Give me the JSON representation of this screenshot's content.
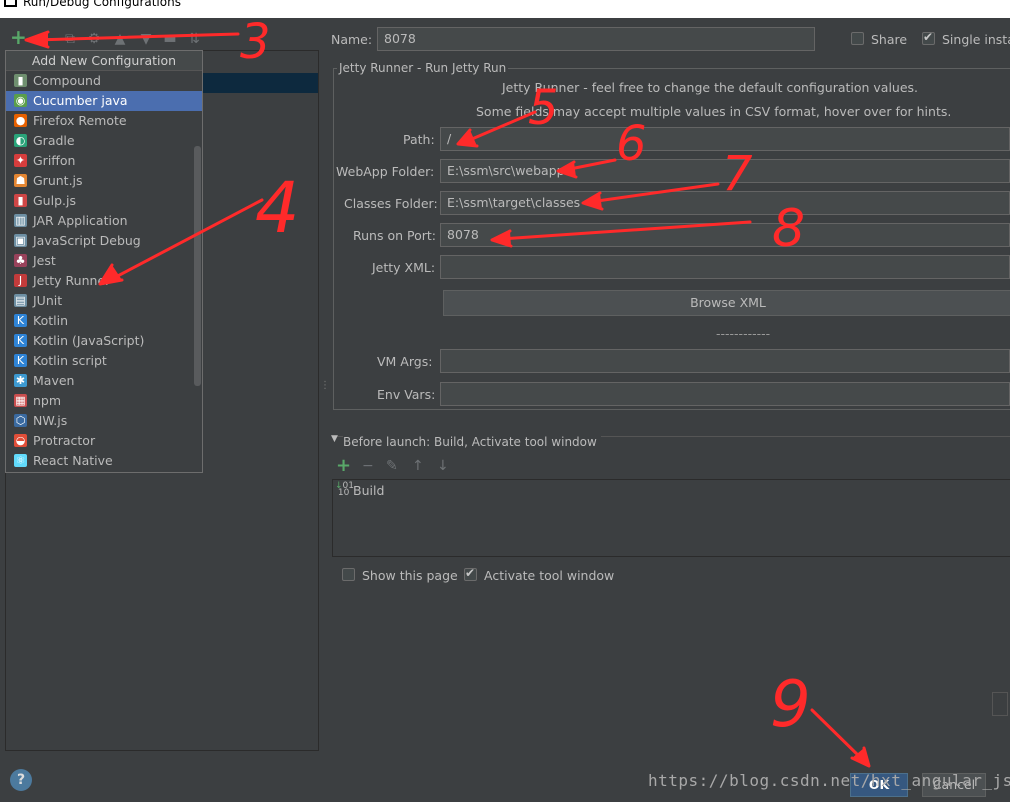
{
  "window": {
    "title": "Run/Debug Configurations"
  },
  "popup": {
    "title": "Add New Configuration",
    "items": [
      {
        "label": "Compound",
        "icon": "folder-icon",
        "color": "#6f8f6f"
      },
      {
        "label": "Cucumber java",
        "icon": "cucumber-icon",
        "color": "#5a9e4b",
        "selected": true
      },
      {
        "label": "Firefox Remote",
        "icon": "firefox-icon",
        "color": "#e66000"
      },
      {
        "label": "Gradle",
        "icon": "gradle-icon",
        "color": "#2aa47a"
      },
      {
        "label": "Griffon",
        "icon": "griffon-icon",
        "color": "#d63d3d"
      },
      {
        "label": "Grunt.js",
        "icon": "grunt-icon",
        "color": "#e48632"
      },
      {
        "label": "Gulp.js",
        "icon": "gulp-icon",
        "color": "#cf4646"
      },
      {
        "label": "JAR Application",
        "icon": "jar-icon",
        "color": "#6d8fa3"
      },
      {
        "label": "JavaScript Debug",
        "icon": "js-debug-icon",
        "color": "#6d8fa3"
      },
      {
        "label": "Jest",
        "icon": "jest-icon",
        "color": "#99425b"
      },
      {
        "label": "Jetty Runner",
        "icon": "jetty-icon",
        "color": "#c23b3b"
      },
      {
        "label": "JUnit",
        "icon": "junit-icon",
        "color": "#6d8fa3"
      },
      {
        "label": "Kotlin",
        "icon": "kotlin-icon",
        "color": "#2f84d6"
      },
      {
        "label": "Kotlin (JavaScript)",
        "icon": "kotlin-js-icon",
        "color": "#2f84d6"
      },
      {
        "label": "Kotlin script",
        "icon": "kotlin-script-icon",
        "color": "#2f84d6"
      },
      {
        "label": "Maven",
        "icon": "maven-gear-icon",
        "color": "#3d9ad1"
      },
      {
        "label": "npm",
        "icon": "npm-icon",
        "color": "#c94e4e"
      },
      {
        "label": "NW.js",
        "icon": "nwjs-icon",
        "color": "#3a6aa0"
      },
      {
        "label": "Protractor",
        "icon": "protractor-icon",
        "color": "#e04e39"
      },
      {
        "label": "React Native",
        "icon": "react-icon",
        "color": "#61dafb"
      }
    ]
  },
  "form": {
    "name_label": "Name:",
    "name_value": "8078",
    "share_label": "Share",
    "single_instance_label": "Single instar",
    "group_title": "Jetty Runner - Run Jetty Run",
    "info_line1": "Jetty Runner - feel free to change the default configuration values.",
    "info_line2": "Some fields may accept multiple values in CSV format, hover over for hints.",
    "path_label": "Path:",
    "path_value": "/",
    "webapp_label": "WebApp Folder:",
    "webapp_value": "E:\\ssm\\src\\webapp",
    "classes_label": "Classes Folder:",
    "classes_value": "E:\\ssm\\target\\classes",
    "port_label": "Runs on Port:",
    "port_value": "8078",
    "jetty_xml_label": "Jetty XML:",
    "jetty_xml_value": "",
    "browse_xml_label": "Browse XML",
    "separator_text": "------------",
    "vm_args_label": "VM Args:",
    "vm_args_value": "",
    "env_vars_label": "Env Vars:",
    "env_vars_value": ""
  },
  "before_launch": {
    "title": "Before launch: Build, Activate tool window",
    "items": [
      {
        "label": "Build"
      }
    ],
    "show_page_label": "Show this page",
    "activate_label": "Activate tool window"
  },
  "buttons": {
    "ok": "OK",
    "cancel": "Cancel",
    "help": "?"
  },
  "watermark": "https://blog.csdn.net/hxt_angular_js",
  "annotations": {
    "color": "#ff2a2a",
    "numbers": [
      "3",
      "4",
      "5",
      "6",
      "7",
      "8",
      "9"
    ]
  }
}
